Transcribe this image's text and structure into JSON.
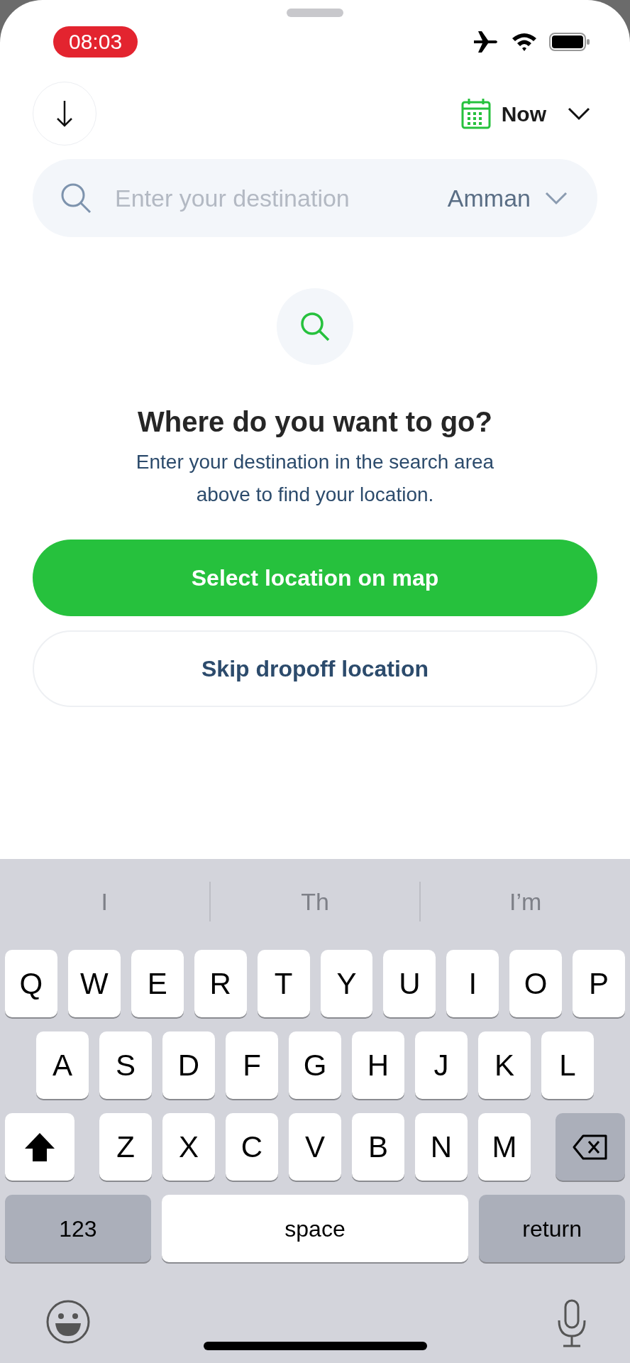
{
  "status_bar": {
    "time": "08:03"
  },
  "header": {
    "time_selector": "Now"
  },
  "search": {
    "placeholder": "Enter your destination",
    "city": "Amman"
  },
  "empty_state": {
    "title": "Where do you want to go?",
    "message": "Enter your destination in the search area above to find your location."
  },
  "buttons": [
    {
      "label": "Select location on map",
      "kind": "primary"
    },
    {
      "label": "Skip dropoff location",
      "kind": "secondary"
    }
  ],
  "keyboard": {
    "suggestions": [
      "I",
      "Th",
      "I’m"
    ],
    "rows": [
      [
        "Q",
        "W",
        "E",
        "R",
        "T",
        "Y",
        "U",
        "I",
        "O",
        "P"
      ],
      [
        "A",
        "S",
        "D",
        "F",
        "G",
        "H",
        "J",
        "K",
        "L"
      ],
      [
        "Z",
        "X",
        "C",
        "V",
        "B",
        "N",
        "M"
      ]
    ],
    "numbers_key": "123",
    "space_key": "space",
    "return_key": "return"
  }
}
